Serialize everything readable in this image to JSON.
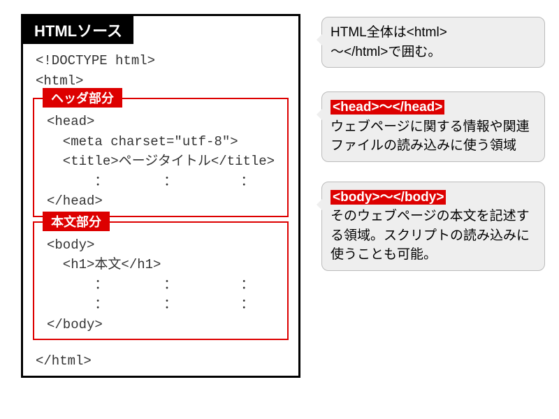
{
  "title": "HTMLソース",
  "intro_code": "<!DOCTYPE html>\n<html>",
  "head_section": {
    "label": "ヘッダ部分",
    "code": "<head>\n  <meta charset=\"utf-8\">\n  <title>ページタイトル</title>\n      ：       ：        ：\n</head>"
  },
  "body_section": {
    "label": "本文部分",
    "code": "<body>\n  <h1>本文</h1>\n      ：       ：        ：\n      ：       ：        ：\n</body>"
  },
  "outro_code": "</html>",
  "notes": {
    "html": {
      "text_a": "HTML全体は<html>",
      "text_b": "～</html>で囲む。"
    },
    "head": {
      "tag": "<head>～</head>",
      "text": "ウェブページに関する情報や関連ファイルの読み込みに使う領域"
    },
    "body": {
      "tag": "<body>～</body>",
      "text": "そのウェブページの本文を記述する領域。スクリプトの読み込みに使うことも可能。"
    }
  }
}
